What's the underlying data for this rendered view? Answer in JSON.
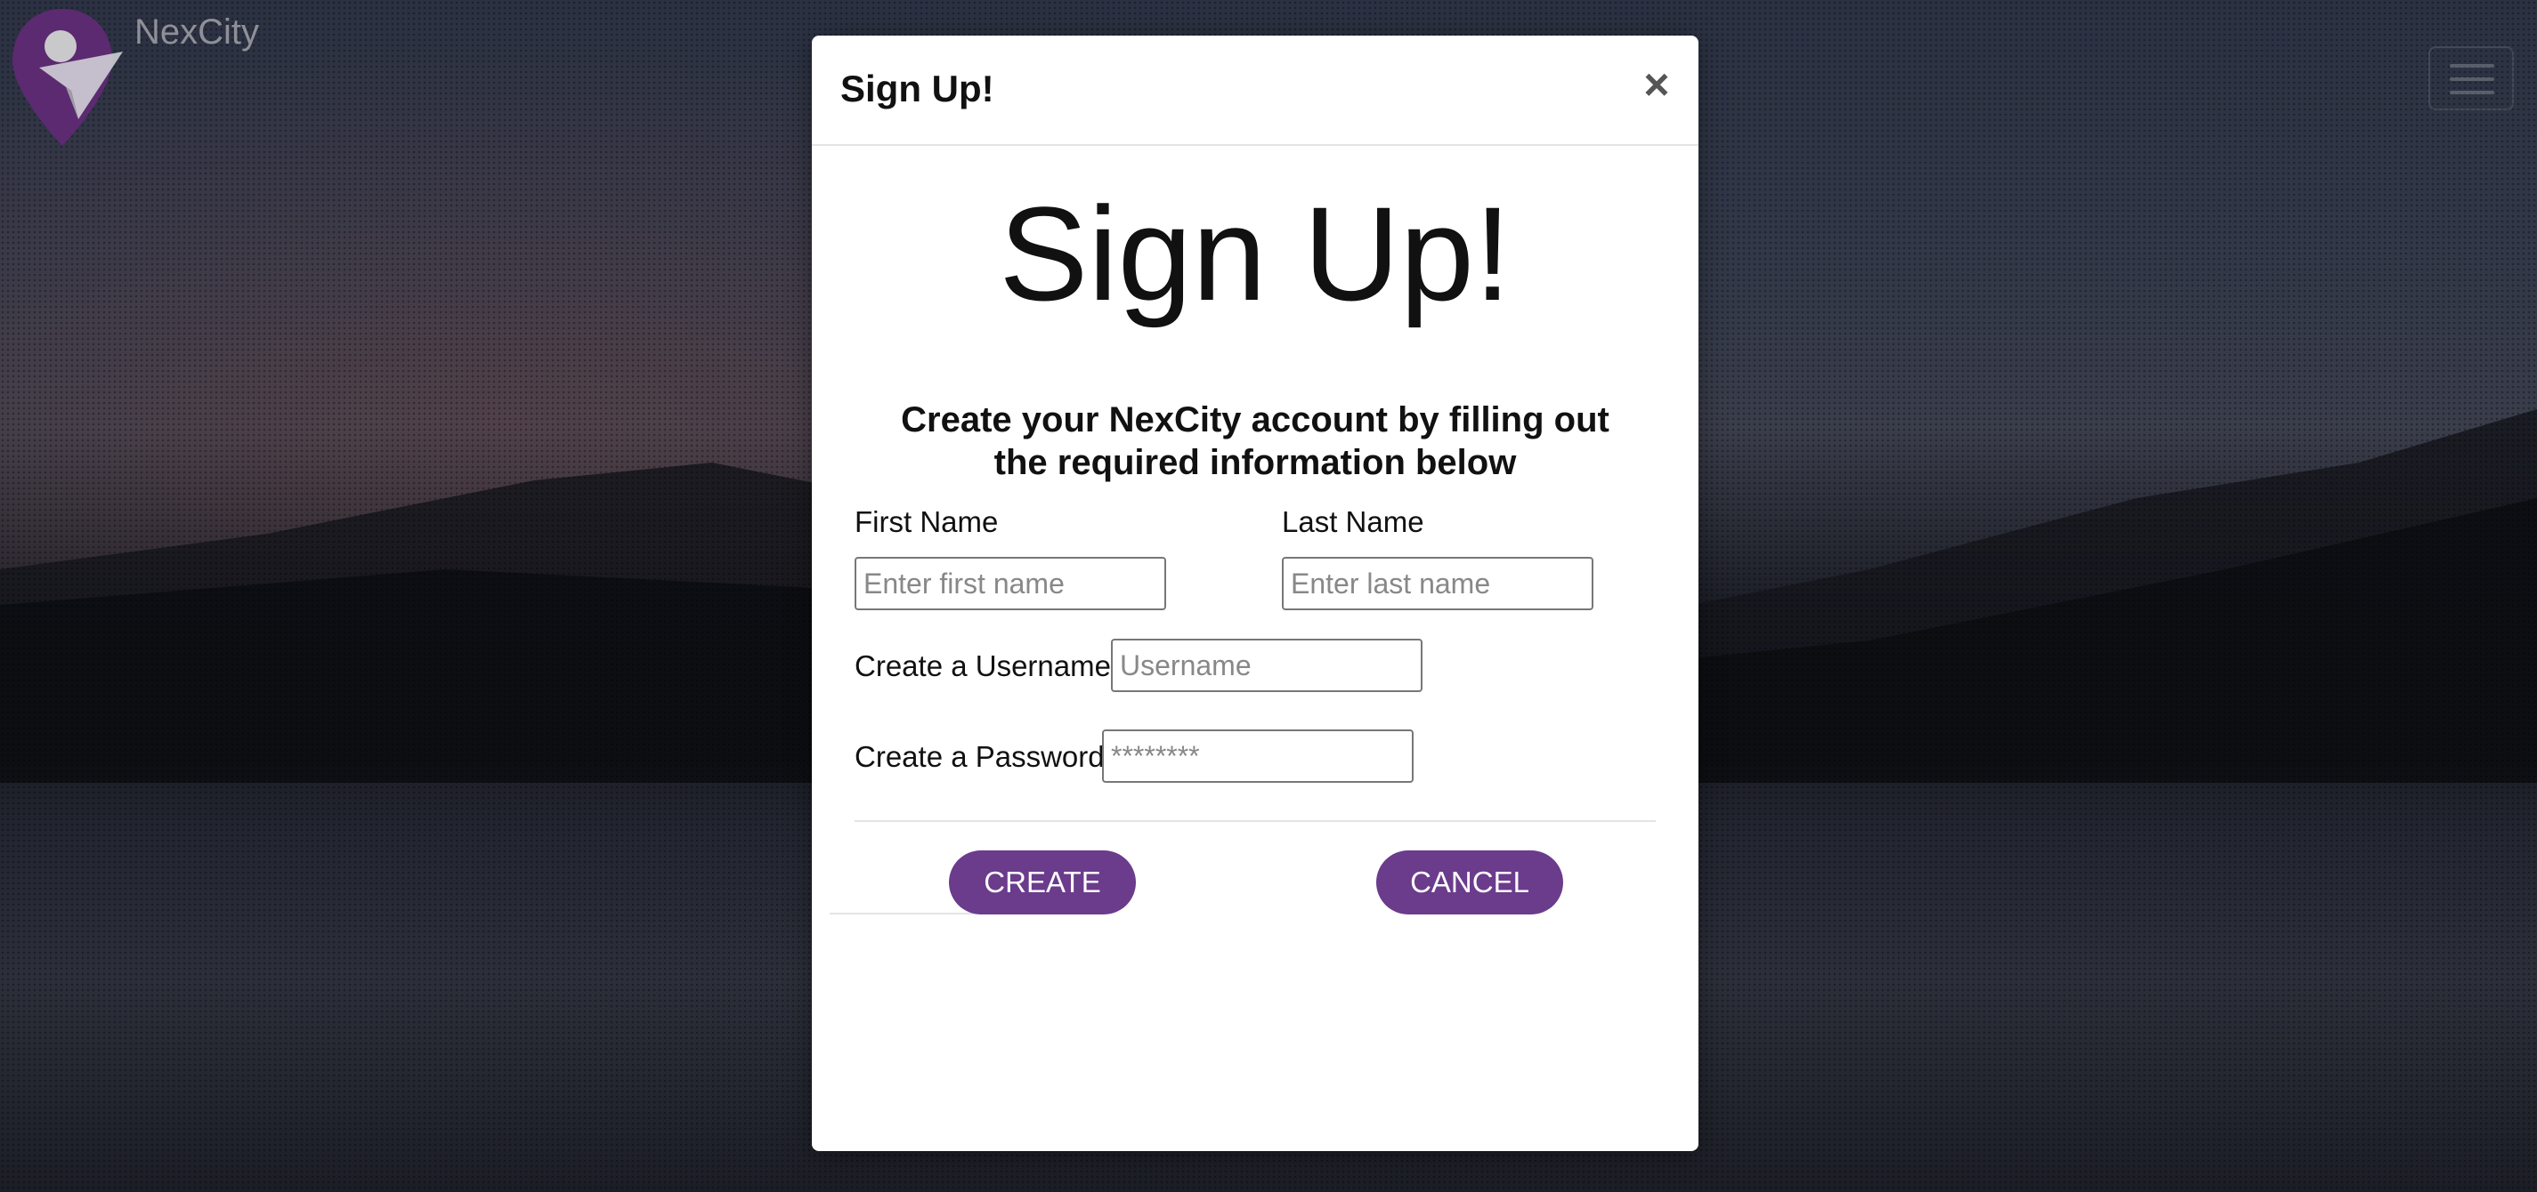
{
  "brand": {
    "name": "NexCity"
  },
  "modal": {
    "header_title": "Sign Up!",
    "close_label": "×",
    "hero_title": "Sign Up!",
    "subtitle": "Create your NexCity account by filling out the required information below",
    "first_name": {
      "label": "First Name",
      "placeholder": "Enter first name",
      "value": ""
    },
    "last_name": {
      "label": "Last Name",
      "placeholder": "Enter last name",
      "value": ""
    },
    "username": {
      "label": "Create a Username",
      "placeholder": "Username",
      "value": ""
    },
    "password": {
      "label": "Create a Password",
      "placeholder": "********",
      "value": ""
    },
    "create_label": "CREATE",
    "cancel_label": "CANCEL"
  },
  "colors": {
    "accent": "#6b3b8c",
    "logo": "#5b2a70"
  }
}
